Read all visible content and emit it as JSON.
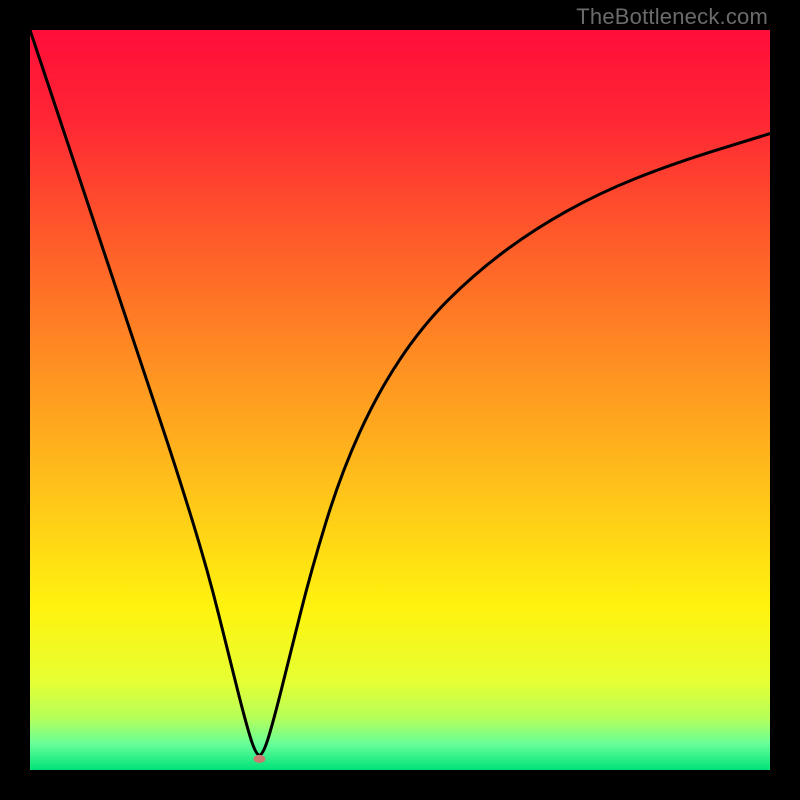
{
  "watermark": "TheBottleneck.com",
  "chart_data": {
    "type": "line",
    "title": "",
    "xlabel": "",
    "ylabel": "",
    "xlim": [
      0,
      100
    ],
    "ylim": [
      0,
      100
    ],
    "gradient_stops": [
      {
        "offset": 0.0,
        "color": "#ff0d3a"
      },
      {
        "offset": 0.12,
        "color": "#ff2634"
      },
      {
        "offset": 0.28,
        "color": "#ff5a2a"
      },
      {
        "offset": 0.45,
        "color": "#ff8f22"
      },
      {
        "offset": 0.62,
        "color": "#ffc21a"
      },
      {
        "offset": 0.78,
        "color": "#fff30e"
      },
      {
        "offset": 0.88,
        "color": "#e6ff33"
      },
      {
        "offset": 0.93,
        "color": "#b5ff5a"
      },
      {
        "offset": 0.965,
        "color": "#66ff99"
      },
      {
        "offset": 1.0,
        "color": "#00e27a"
      }
    ],
    "series": [
      {
        "name": "bottleneck-curve",
        "x": [
          0,
          4,
          8,
          12,
          16,
          20,
          24,
          27,
          29,
          30.5,
          31.5,
          33,
          35,
          38,
          42,
          47,
          53,
          60,
          68,
          77,
          87,
          100
        ],
        "values": [
          100,
          88,
          76,
          64,
          52,
          40,
          27,
          15,
          7,
          2,
          2,
          7,
          15,
          27,
          40,
          51,
          60,
          67,
          73,
          78,
          82,
          86
        ]
      }
    ],
    "minimum_marker": {
      "x": 31,
      "y": 1.5,
      "rx": 6,
      "ry": 4,
      "color": "#c97b6f"
    }
  }
}
